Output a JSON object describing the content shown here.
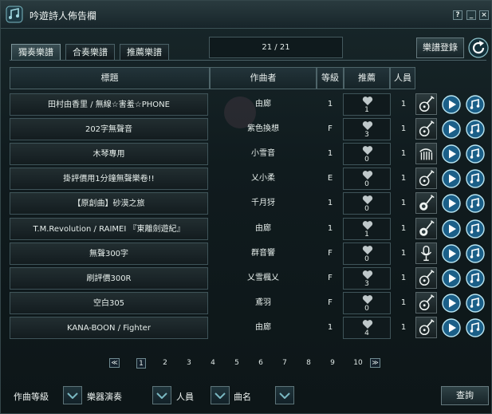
{
  "window": {
    "title": "吟遊詩人佈告欄"
  },
  "window_controls": {
    "help": "?",
    "minimize": "_",
    "close": "×"
  },
  "tabs": [
    {
      "label": "獨奏樂譜",
      "active": true
    },
    {
      "label": "合奏樂譜",
      "active": false
    },
    {
      "label": "推薦樂譜",
      "active": false
    }
  ],
  "page_counter": "21 / 21",
  "register_button": "樂譜登錄",
  "columns": {
    "title": "標題",
    "composer": "作曲者",
    "level": "等級",
    "recommend": "推薦",
    "players": "人員"
  },
  "rows": [
    {
      "title": "田村由香里 / 無線☆害羞☆PHONE",
      "composer": "由廊",
      "level": "1",
      "recommend": "1",
      "players": "1",
      "instrument": "lute-icon"
    },
    {
      "title": "202字無聲音",
      "composer": "紫色換想",
      "level": "F",
      "recommend": "3",
      "players": "1",
      "instrument": "lute-icon"
    },
    {
      "title": "木琴專用",
      "composer": "小雪音",
      "level": "1",
      "recommend": "0",
      "players": "1",
      "instrument": "xylophone-icon"
    },
    {
      "title": "掛評價用1分鐘無聲樂卷!!",
      "composer": "乂小柔",
      "level": "E",
      "recommend": "0",
      "players": "1",
      "instrument": "lute-icon"
    },
    {
      "title": "【原創曲】砂漠之旅",
      "composer": "千月犽",
      "level": "1",
      "recommend": "0",
      "players": "1",
      "instrument": "banjo-icon"
    },
    {
      "title": "T.M.Revolution / RAIMEI 『東離劍遊紀』",
      "composer": "由廊",
      "level": "1",
      "recommend": "1",
      "players": "1",
      "instrument": "banjo-icon"
    },
    {
      "title": "無聲300字",
      "composer": "群音響",
      "level": "F",
      "recommend": "0",
      "players": "1",
      "instrument": "microphone-icon"
    },
    {
      "title": "刷評價300R",
      "composer": "乂雪楓乂",
      "level": "F",
      "recommend": "3",
      "players": "1",
      "instrument": "lute-icon"
    },
    {
      "title": "空白305",
      "composer": "鳶羽",
      "level": "F",
      "recommend": "0",
      "players": "1",
      "instrument": "lute-icon"
    },
    {
      "title": "KANA-BOON / Fighter",
      "composer": "由廊",
      "level": "1",
      "recommend": "4",
      "players": "1",
      "instrument": "lute-icon"
    }
  ],
  "pagination": {
    "first": "≪",
    "last": "≫",
    "pages": [
      "1",
      "2",
      "3",
      "4",
      "5",
      "6",
      "7",
      "8",
      "9",
      "10"
    ],
    "current": "1"
  },
  "filters": {
    "level_label": "作曲等級",
    "instrument_label": "樂器演奏",
    "players_label": "人員",
    "song_label": "曲名",
    "search_button": "查詢"
  },
  "colors": {
    "accent": "#7ab8c2",
    "play_button": "#2b7fb0",
    "heart": "#bfc8ca"
  }
}
